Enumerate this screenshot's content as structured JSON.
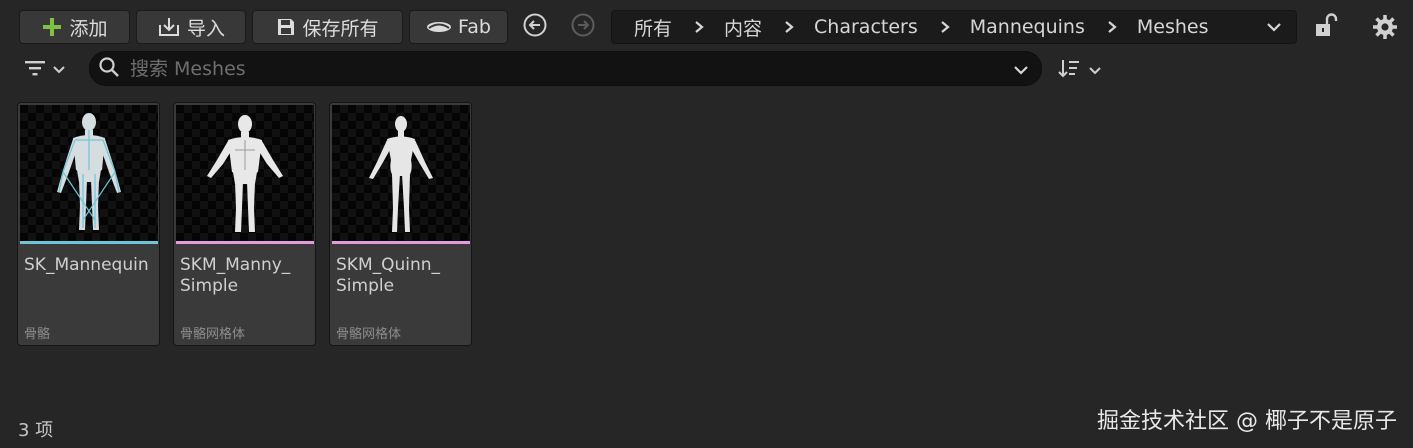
{
  "toolbar": {
    "add_label": "添加",
    "import_label": "导入",
    "save_all_label": "保存所有",
    "fab_label": "Fab"
  },
  "breadcrumb": [
    "所有",
    "内容",
    "Characters",
    "Mannequins",
    "Meshes"
  ],
  "search": {
    "placeholder": "搜索 Meshes",
    "value": ""
  },
  "assets": [
    {
      "name": "SK_Mannequin",
      "type": "骨骼",
      "color": "#6cc6d8"
    },
    {
      "name": "SKM_Manny_ Simple",
      "type": "骨骼网格体",
      "color": "#e59ae0"
    },
    {
      "name": "SKM_Quinn_ Simple",
      "type": "骨骼网格体",
      "color": "#e59ae0"
    }
  ],
  "status": {
    "count_label": "3 项"
  },
  "watermark": "掘金技术社区 @ 椰子不是原子",
  "colors": {
    "accent_plus": "#7fc241",
    "skeleton": "#6cc6d8",
    "skeletal_mesh": "#e59ae0"
  }
}
